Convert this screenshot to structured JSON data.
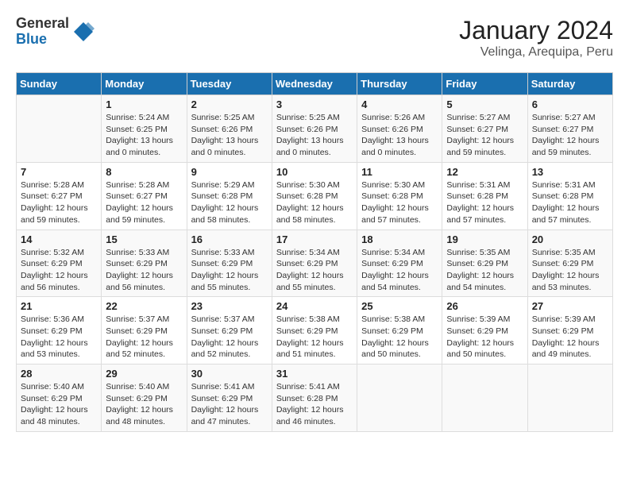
{
  "logo": {
    "general": "General",
    "blue": "Blue"
  },
  "title": "January 2024",
  "subtitle": "Velinga, Arequipa, Peru",
  "days_of_week": [
    "Sunday",
    "Monday",
    "Tuesday",
    "Wednesday",
    "Thursday",
    "Friday",
    "Saturday"
  ],
  "weeks": [
    [
      {
        "day": "",
        "info": ""
      },
      {
        "day": "1",
        "info": "Sunrise: 5:24 AM\nSunset: 6:25 PM\nDaylight: 13 hours\nand 0 minutes."
      },
      {
        "day": "2",
        "info": "Sunrise: 5:25 AM\nSunset: 6:26 PM\nDaylight: 13 hours\nand 0 minutes."
      },
      {
        "day": "3",
        "info": "Sunrise: 5:25 AM\nSunset: 6:26 PM\nDaylight: 13 hours\nand 0 minutes."
      },
      {
        "day": "4",
        "info": "Sunrise: 5:26 AM\nSunset: 6:26 PM\nDaylight: 13 hours\nand 0 minutes."
      },
      {
        "day": "5",
        "info": "Sunrise: 5:27 AM\nSunset: 6:27 PM\nDaylight: 12 hours\nand 59 minutes."
      },
      {
        "day": "6",
        "info": "Sunrise: 5:27 AM\nSunset: 6:27 PM\nDaylight: 12 hours\nand 59 minutes."
      }
    ],
    [
      {
        "day": "7",
        "info": "Sunrise: 5:28 AM\nSunset: 6:27 PM\nDaylight: 12 hours\nand 59 minutes."
      },
      {
        "day": "8",
        "info": "Sunrise: 5:28 AM\nSunset: 6:27 PM\nDaylight: 12 hours\nand 59 minutes."
      },
      {
        "day": "9",
        "info": "Sunrise: 5:29 AM\nSunset: 6:28 PM\nDaylight: 12 hours\nand 58 minutes."
      },
      {
        "day": "10",
        "info": "Sunrise: 5:30 AM\nSunset: 6:28 PM\nDaylight: 12 hours\nand 58 minutes."
      },
      {
        "day": "11",
        "info": "Sunrise: 5:30 AM\nSunset: 6:28 PM\nDaylight: 12 hours\nand 57 minutes."
      },
      {
        "day": "12",
        "info": "Sunrise: 5:31 AM\nSunset: 6:28 PM\nDaylight: 12 hours\nand 57 minutes."
      },
      {
        "day": "13",
        "info": "Sunrise: 5:31 AM\nSunset: 6:28 PM\nDaylight: 12 hours\nand 57 minutes."
      }
    ],
    [
      {
        "day": "14",
        "info": "Sunrise: 5:32 AM\nSunset: 6:29 PM\nDaylight: 12 hours\nand 56 minutes."
      },
      {
        "day": "15",
        "info": "Sunrise: 5:33 AM\nSunset: 6:29 PM\nDaylight: 12 hours\nand 56 minutes."
      },
      {
        "day": "16",
        "info": "Sunrise: 5:33 AM\nSunset: 6:29 PM\nDaylight: 12 hours\nand 55 minutes."
      },
      {
        "day": "17",
        "info": "Sunrise: 5:34 AM\nSunset: 6:29 PM\nDaylight: 12 hours\nand 55 minutes."
      },
      {
        "day": "18",
        "info": "Sunrise: 5:34 AM\nSunset: 6:29 PM\nDaylight: 12 hours\nand 54 minutes."
      },
      {
        "day": "19",
        "info": "Sunrise: 5:35 AM\nSunset: 6:29 PM\nDaylight: 12 hours\nand 54 minutes."
      },
      {
        "day": "20",
        "info": "Sunrise: 5:35 AM\nSunset: 6:29 PM\nDaylight: 12 hours\nand 53 minutes."
      }
    ],
    [
      {
        "day": "21",
        "info": "Sunrise: 5:36 AM\nSunset: 6:29 PM\nDaylight: 12 hours\nand 53 minutes."
      },
      {
        "day": "22",
        "info": "Sunrise: 5:37 AM\nSunset: 6:29 PM\nDaylight: 12 hours\nand 52 minutes."
      },
      {
        "day": "23",
        "info": "Sunrise: 5:37 AM\nSunset: 6:29 PM\nDaylight: 12 hours\nand 52 minutes."
      },
      {
        "day": "24",
        "info": "Sunrise: 5:38 AM\nSunset: 6:29 PM\nDaylight: 12 hours\nand 51 minutes."
      },
      {
        "day": "25",
        "info": "Sunrise: 5:38 AM\nSunset: 6:29 PM\nDaylight: 12 hours\nand 50 minutes."
      },
      {
        "day": "26",
        "info": "Sunrise: 5:39 AM\nSunset: 6:29 PM\nDaylight: 12 hours\nand 50 minutes."
      },
      {
        "day": "27",
        "info": "Sunrise: 5:39 AM\nSunset: 6:29 PM\nDaylight: 12 hours\nand 49 minutes."
      }
    ],
    [
      {
        "day": "28",
        "info": "Sunrise: 5:40 AM\nSunset: 6:29 PM\nDaylight: 12 hours\nand 48 minutes."
      },
      {
        "day": "29",
        "info": "Sunrise: 5:40 AM\nSunset: 6:29 PM\nDaylight: 12 hours\nand 48 minutes."
      },
      {
        "day": "30",
        "info": "Sunrise: 5:41 AM\nSunset: 6:29 PM\nDaylight: 12 hours\nand 47 minutes."
      },
      {
        "day": "31",
        "info": "Sunrise: 5:41 AM\nSunset: 6:28 PM\nDaylight: 12 hours\nand 46 minutes."
      },
      {
        "day": "",
        "info": ""
      },
      {
        "day": "",
        "info": ""
      },
      {
        "day": "",
        "info": ""
      }
    ]
  ]
}
